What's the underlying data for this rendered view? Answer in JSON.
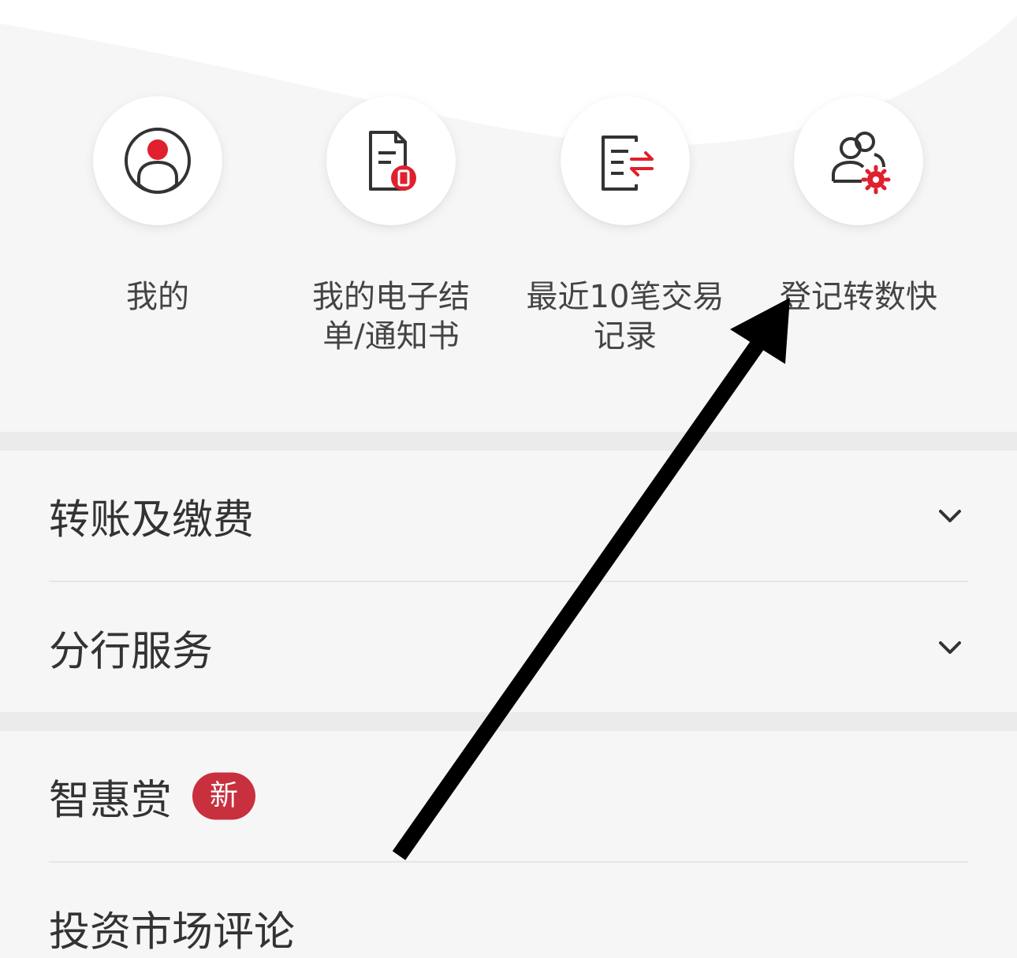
{
  "quick_actions": [
    {
      "label": "我的",
      "icon": "user-profile-icon"
    },
    {
      "label": "我的电子结\n单/通知书",
      "icon": "e-statement-icon"
    },
    {
      "label": "最近10笔交易\n记录",
      "icon": "transaction-record-icon"
    },
    {
      "label": "登记转数快",
      "icon": "fps-register-icon"
    }
  ],
  "menu": {
    "group1": [
      {
        "label": "转账及缴费",
        "icon": "chevron-down-icon"
      },
      {
        "label": "分行服务",
        "icon": "chevron-down-icon"
      }
    ],
    "group2": [
      {
        "label": "智惠赏",
        "badge": "新"
      },
      {
        "label": "投资市场评论"
      }
    ]
  },
  "colors": {
    "accent": "#e0202e",
    "badge": "#c8303d",
    "icon_stroke": "#333333",
    "background": "#f6f6f6"
  }
}
